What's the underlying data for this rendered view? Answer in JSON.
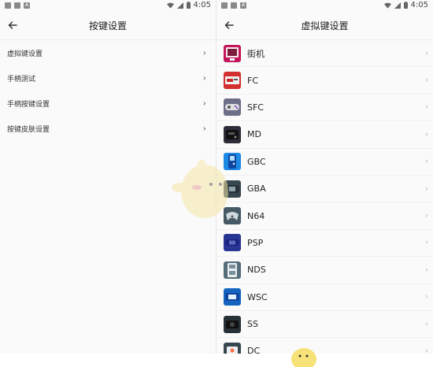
{
  "status_bar": {
    "time": "4:05",
    "notification_icons": [
      "A",
      "A"
    ],
    "icons": [
      "wifi-icon",
      "signal-icon",
      "battery-icon"
    ]
  },
  "left_screen": {
    "title": "按键设置",
    "items": [
      {
        "label": "虚拟键设置"
      },
      {
        "label": "手柄测试"
      },
      {
        "label": "手柄按键设置"
      },
      {
        "label": "按键皮肤设置"
      }
    ]
  },
  "right_screen": {
    "title": "虚拟键设置",
    "items": [
      {
        "label": "街机",
        "icon": "arcade-icon",
        "color": "#c2185b"
      },
      {
        "label": "FC",
        "icon": "fc-console-icon",
        "color": "#d32f2f"
      },
      {
        "label": "SFC",
        "icon": "sfc-controller-icon",
        "color": "#6d6f8a"
      },
      {
        "label": "MD",
        "icon": "md-console-icon",
        "color": "#2d2d3a"
      },
      {
        "label": "GBC",
        "icon": "gbc-handheld-icon",
        "color": "#1e88e5"
      },
      {
        "label": "GBA",
        "icon": "gba-handheld-icon",
        "color": "#37474f"
      },
      {
        "label": "N64",
        "icon": "n64-controller-icon",
        "color": "#455a64"
      },
      {
        "label": "PSP",
        "icon": "psp-handheld-icon",
        "color": "#283593"
      },
      {
        "label": "NDS",
        "icon": "nds-handheld-icon",
        "color": "#546e7a"
      },
      {
        "label": "WSC",
        "icon": "wsc-handheld-icon",
        "color": "#1565c0"
      },
      {
        "label": "SS",
        "icon": "ss-console-icon",
        "color": "#263238"
      },
      {
        "label": "DC",
        "icon": "dc-console-icon",
        "color": "#37474f"
      }
    ]
  },
  "colors": {
    "background": "#fafafa",
    "text": "#222222",
    "divider": "#ececec"
  }
}
